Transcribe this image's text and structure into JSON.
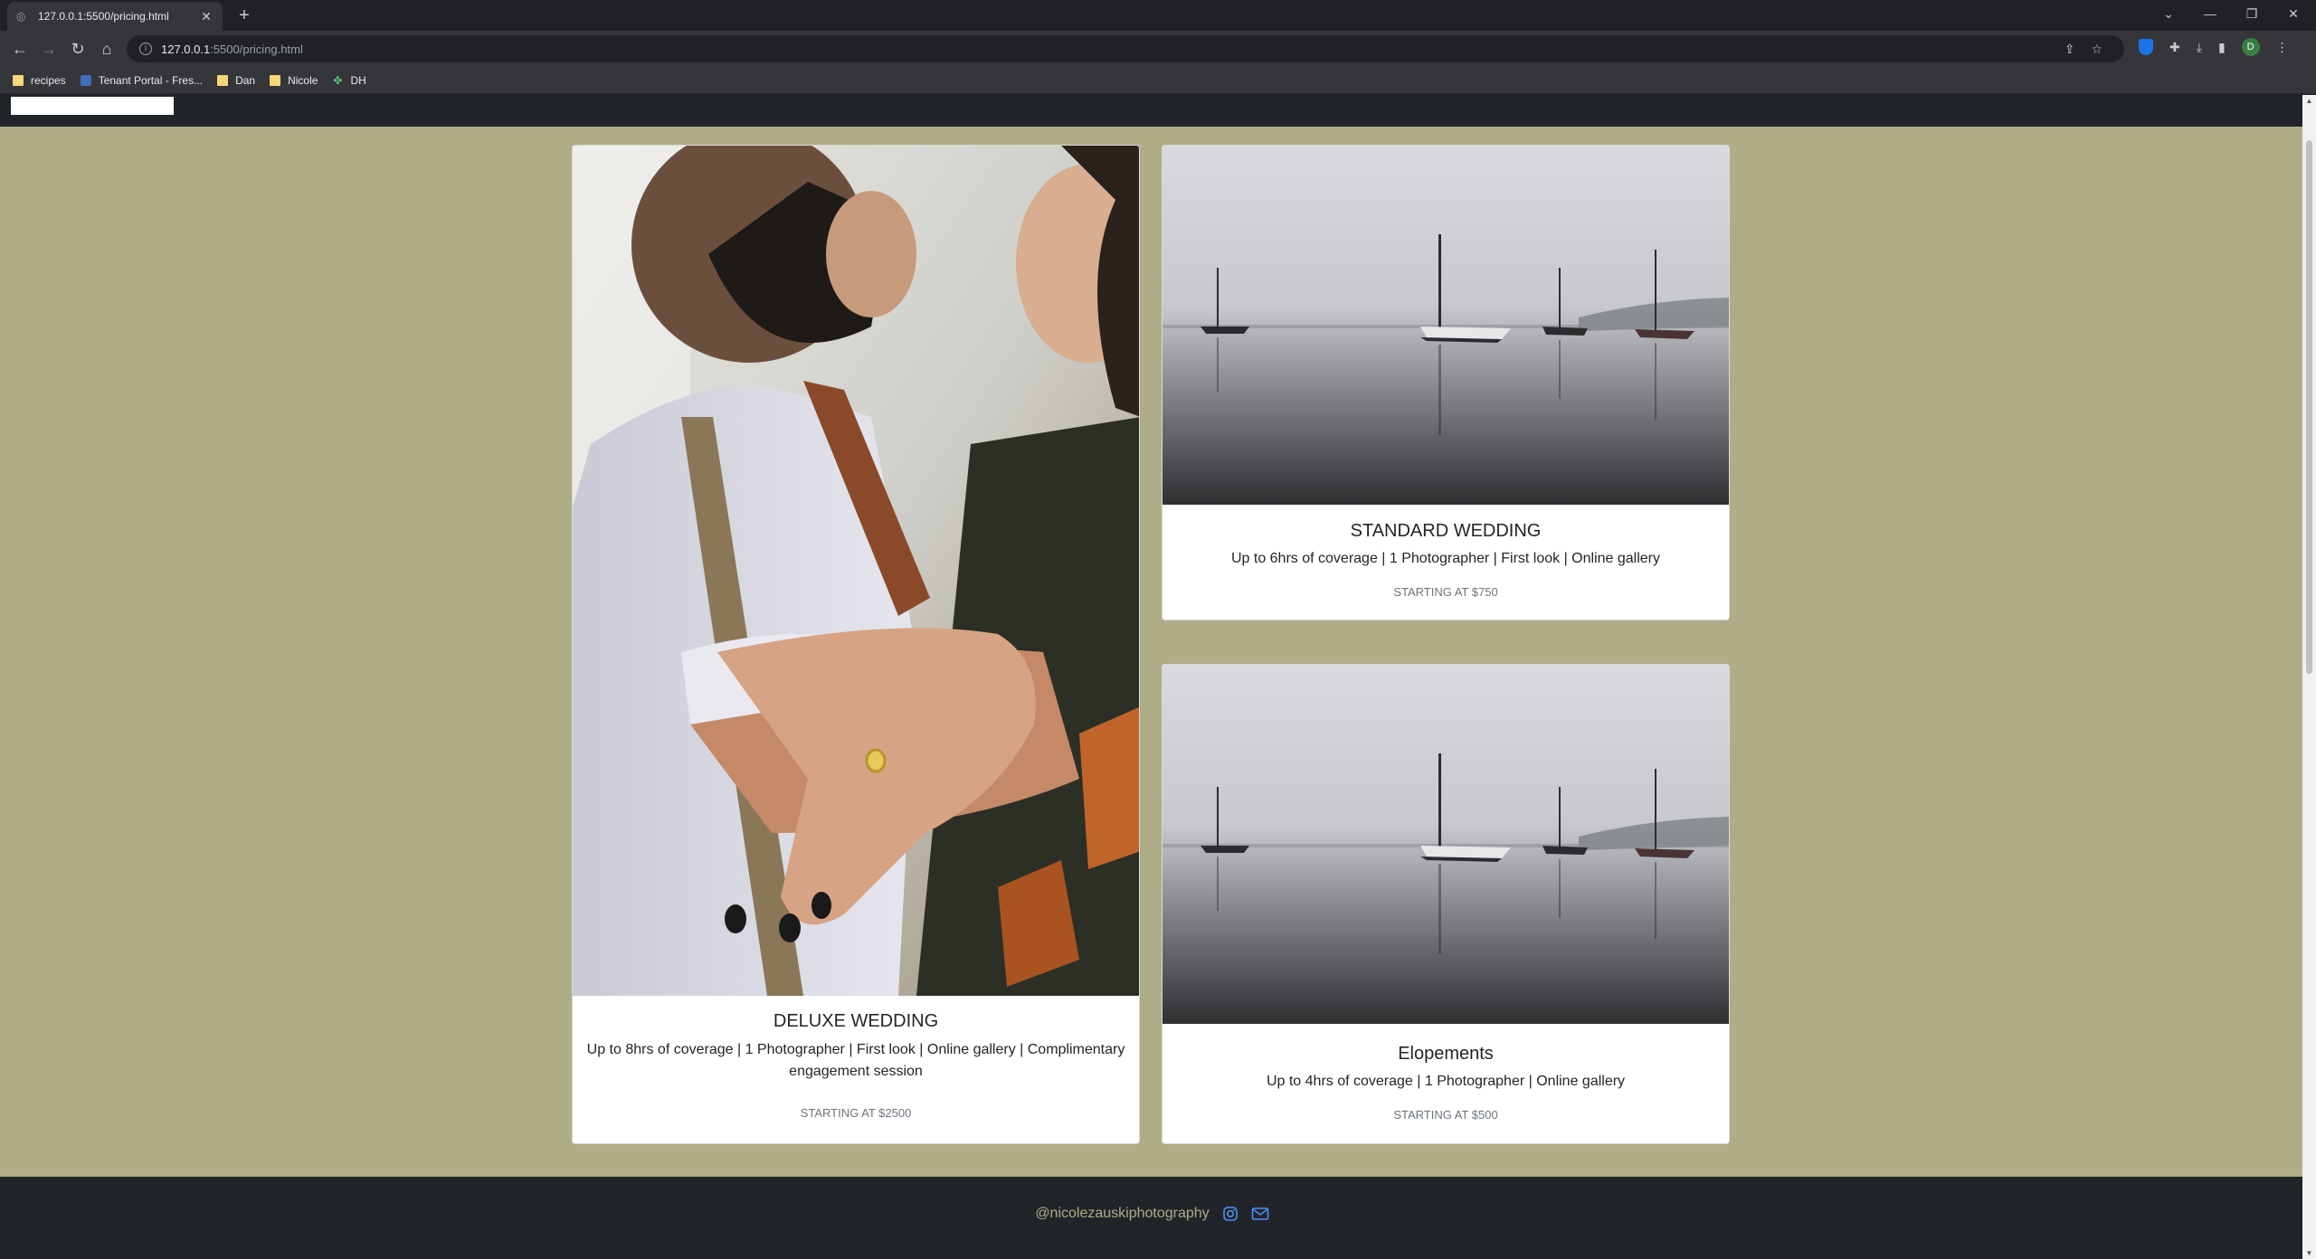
{
  "browser": {
    "tab_title": "127.0.0.1:5500/pricing.html",
    "tab_close": "✕",
    "new_tab": "+",
    "url_host": "127.0.0.1",
    "url_path": ":5500/pricing.html",
    "avatar_initial": "D",
    "bookmarks": [
      {
        "label": "recipes",
        "icon": "folder-icon"
      },
      {
        "label": "Tenant Portal - Fres...",
        "icon": "portal-icon"
      },
      {
        "label": "Dan",
        "icon": "folder-icon"
      },
      {
        "label": "Nicole",
        "icon": "folder-icon"
      },
      {
        "label": "DH",
        "icon": "dh-icon"
      }
    ]
  },
  "page": {
    "background": "#aead88",
    "cards": {
      "deluxe": {
        "title": "DELUXE WEDDING",
        "text": "Up to 8hrs of coverage | 1 Photographer | First look | Online gallery | Complimentary engagement session",
        "price": "STARTING AT $2500",
        "image": "couple-kissing-ring-photo"
      },
      "standard": {
        "title": "STANDARD WEDDING",
        "text": "Up to 6hrs of coverage | 1 Photographer | First look | Online gallery",
        "price": "STARTING AT $750",
        "image": "foggy-lake-sailboats-photo"
      },
      "elopements": {
        "title": "Elopements",
        "text": "Up to 4hrs of coverage | 1 Photographer | Online gallery",
        "price": "STARTING AT $500",
        "image": "foggy-lake-sailboats-photo"
      }
    },
    "footer": {
      "handle": "@nicolezauskiphotography",
      "icons": [
        "instagram-icon",
        "envelope-icon"
      ]
    }
  }
}
